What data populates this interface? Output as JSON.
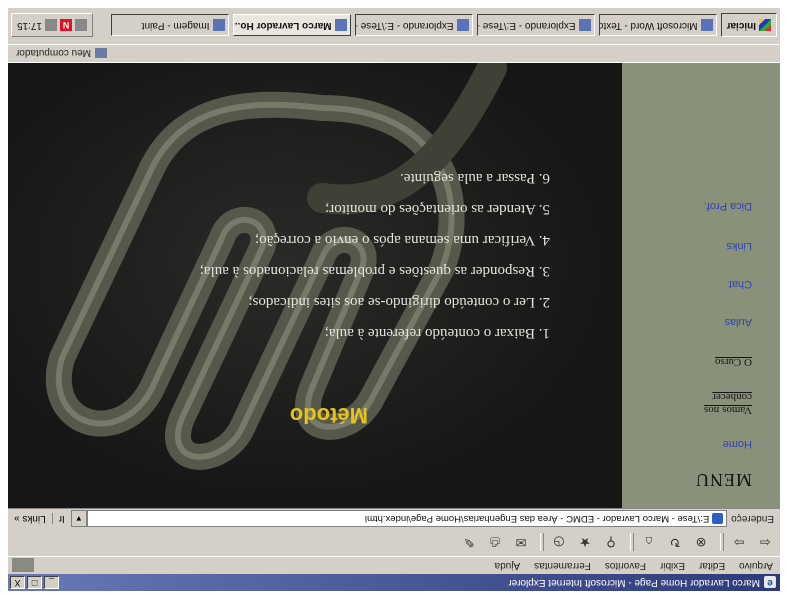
{
  "window": {
    "title": "Marco Lavrador Home Page - Microsoft Internet Explorer",
    "minimize": "_",
    "restore": "□",
    "close": "X"
  },
  "menubar": {
    "items": [
      "Arquivo",
      "Editar",
      "Exibir",
      "Favoritos",
      "Ferramentas",
      "Ajuda"
    ]
  },
  "toolbar": {
    "icons": [
      "back-icon",
      "forward-icon",
      "stop-icon",
      "refresh-icon",
      "home-icon",
      "search-icon",
      "favorites-icon",
      "history-icon",
      "mail-icon",
      "print-icon",
      "edit-icon"
    ]
  },
  "addressbar": {
    "label": "Endereço",
    "url": "E:\\Tese - Marco Lavrador - EDMC - Área das Engenharias\\Home Page\\index.html",
    "go": "Ir",
    "links": "Links »"
  },
  "sidebar": {
    "menu_title": "MENU",
    "items": [
      {
        "label": "Home",
        "kind": "link"
      },
      {
        "label": "Vamos nos conhecer",
        "kind": "text"
      },
      {
        "label": "O Curso",
        "kind": "text"
      },
      {
        "label": "Aulas",
        "kind": "link"
      },
      {
        "label": "Chat",
        "kind": "link"
      },
      {
        "label": "Links",
        "kind": "link"
      },
      {
        "label": "Dica Prof.",
        "kind": "link"
      }
    ]
  },
  "main": {
    "title": "Método",
    "steps": [
      "1. Baixar o conteúdo referente à aula;",
      "2. Ler o conteúdo dirigindo-se aos sites indicados;",
      "3. Responder as questões e problemas relacionados à aula;",
      "4. Verificar uma semana após o envio a correção;",
      "5. Atender as orientações do monitor;",
      "6. Passar a aula seguinte."
    ],
    "colors": {
      "title": "#e6c21a",
      "text": "#e4e4dc",
      "background": "#1c1c1c",
      "sidebar": "#8a917a"
    }
  },
  "statusbar": {
    "zone": "Meu computador"
  },
  "taskbar": {
    "start": "Iniciar",
    "tasks": [
      {
        "label": "Microsoft Word - Texto ...",
        "active": false
      },
      {
        "label": "Explorando - E:\\Tese - ...",
        "active": false
      },
      {
        "label": "Explorando - E:\\Tese - ...",
        "active": false
      },
      {
        "label": "Marco Lavrador Ho...",
        "active": true
      },
      {
        "label": "Imagem - Paint",
        "active": false
      }
    ],
    "clock": "17:15"
  }
}
